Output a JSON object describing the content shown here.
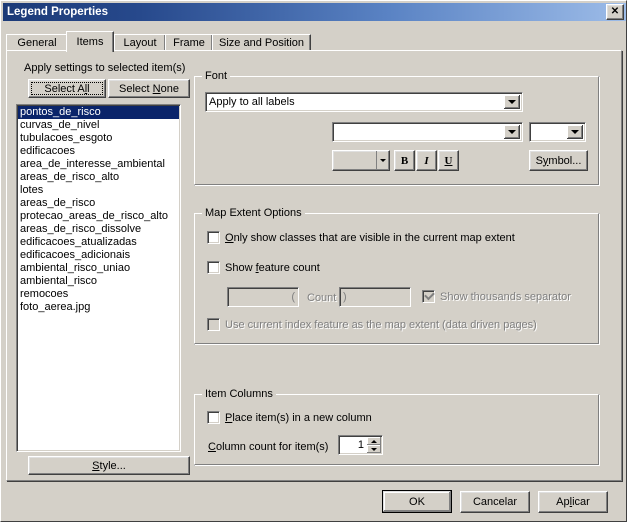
{
  "window": {
    "title": "Legend Properties",
    "close_label": "✕"
  },
  "tabs": [
    {
      "label": "General",
      "active": false
    },
    {
      "label": "Items",
      "active": true
    },
    {
      "label": "Layout",
      "active": false
    },
    {
      "label": "Frame",
      "active": false
    },
    {
      "label": "Size and Position",
      "active": false
    }
  ],
  "left_panel": {
    "apply_label": "Apply settings to selected item(s)",
    "select_all_label": "Select All",
    "select_none_label": "Select None",
    "style_label": "Style...",
    "items": [
      "pontos_de_risco",
      "curvas_de_nivel",
      "tubulacoes_esgoto",
      "edificacoes",
      "area_de_interesse_ambiental",
      "areas_de_risco_alto",
      "lotes",
      "areas_de_risco",
      "protecao_areas_de_risco_alto",
      "areas_de_risco_dissolve",
      "edificacoes_atualizadas",
      "edificacoes_adicionais",
      "ambiental_risco_uniao",
      "ambiental_risco",
      "remocoes",
      "foto_aerea.jpg"
    ],
    "selected_index": 0
  },
  "font_group": {
    "title": "Font",
    "apply_combo_value": "Apply to all labels",
    "font_name_value": "",
    "font_size_value": "",
    "color_value": "",
    "bold_label": "B",
    "italic_label": "I",
    "underline_label": "U",
    "symbol_label": "Symbol..."
  },
  "map_extent_group": {
    "title": "Map Extent Options",
    "only_show_visible": {
      "label": "Only show classes that are visible in the current map extent",
      "checked": false,
      "enabled": true
    },
    "show_feature_count": {
      "label": "Show feature count",
      "checked": false,
      "enabled": true
    },
    "prefix_value": "(",
    "count_label": "Count",
    "suffix_value": ")",
    "thousands_separator": {
      "label": "Show thousands separator",
      "checked": true,
      "enabled": false
    },
    "use_index_feature": {
      "label": "Use current index feature as the map extent (data driven pages)",
      "checked": false,
      "enabled": false
    }
  },
  "item_columns_group": {
    "title": "Item Columns",
    "place_new_column": {
      "label": "Place item(s) in a new column",
      "checked": false
    },
    "column_count_label": "Column count for item(s)",
    "column_count_value": "1"
  },
  "footer": {
    "ok_label": "OK",
    "cancel_label": "Cancelar",
    "apply_label": "Aplicar"
  },
  "colors": {
    "dialog_face": "#d4d0c8",
    "title_gradient_start": "#1c3a77",
    "title_gradient_end": "#9dbce8",
    "selection": "#0a246a",
    "disabled_text": "#808080"
  }
}
